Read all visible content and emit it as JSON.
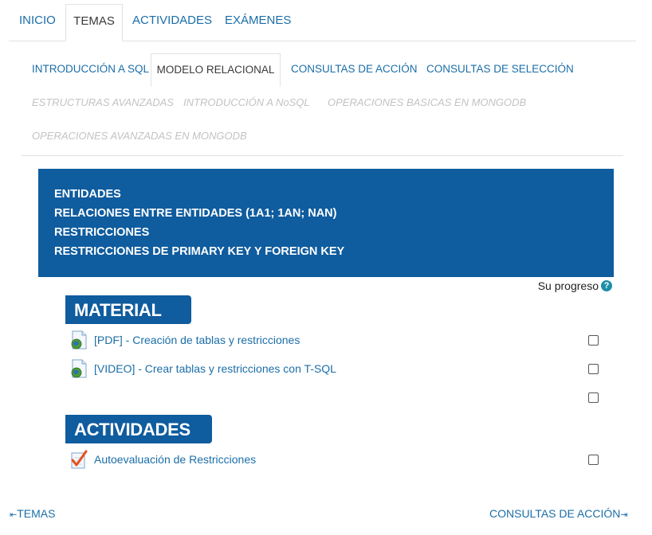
{
  "top_tabs": [
    {
      "label": "INICIO",
      "active": false
    },
    {
      "label": "TEMAS",
      "active": true
    },
    {
      "label": "ACTIVIDADES",
      "active": false
    },
    {
      "label": "EXÁMENES",
      "active": false
    }
  ],
  "sub_tabs": [
    {
      "label": "INTRODUCCIÓN A SQL",
      "state": "link"
    },
    {
      "label": "MODELO RELACIONAL",
      "state": "active"
    },
    {
      "label": "CONSULTAS DE ACCIÓN",
      "state": "link"
    },
    {
      "label": "CONSULTAS DE SELECCIÓN",
      "state": "link"
    },
    {
      "label": "ESTRUCTURAS AVANZADAS",
      "state": "disabled"
    },
    {
      "label": "INTRODUCCIÓN A NoSQL",
      "state": "disabled"
    },
    {
      "label": "OPERACIONES BASICAS EN MONGODB",
      "state": "disabled"
    },
    {
      "label": "OPERACIONES AVANZADAS EN MONGODB",
      "state": "disabled"
    }
  ],
  "summary": {
    "lines": [
      "ENTIDADES",
      "RELACIONES ENTRE ENTIDADES (1A1; 1AN; NAN)",
      "RESTRICCIONES",
      "RESTRICCIONES DE PRIMARY KEY Y FOREIGN KEY"
    ]
  },
  "progress": {
    "label": "Su progreso",
    "icon": "help-icon"
  },
  "sections": {
    "material": {
      "title": "MATERIAL",
      "items": [
        {
          "label": "[PDF] - Creación de tablas y restricciones",
          "icon": "resource-file-icon",
          "checked": false
        },
        {
          "label": "[VIDEO] - Crear tablas y restricciones con T-SQL",
          "icon": "resource-file-icon",
          "checked": false
        }
      ],
      "extra_checkbox_checked": false
    },
    "actividades": {
      "title": "ACTIVIDADES",
      "items": [
        {
          "label": "Autoevaluación de Restricciones",
          "icon": "quiz-check-icon",
          "checked": false
        }
      ]
    }
  },
  "bottom_nav": {
    "prev": "TEMAS",
    "next": "CONSULTAS DE ACCIÓN",
    "prev_icon": "arrow-left-bar-icon",
    "next_icon": "arrow-right-bar-icon"
  },
  "colors": {
    "accent": "#0f5c9e",
    "link": "#1b6ea8",
    "disabled": "#c3c3c3"
  }
}
